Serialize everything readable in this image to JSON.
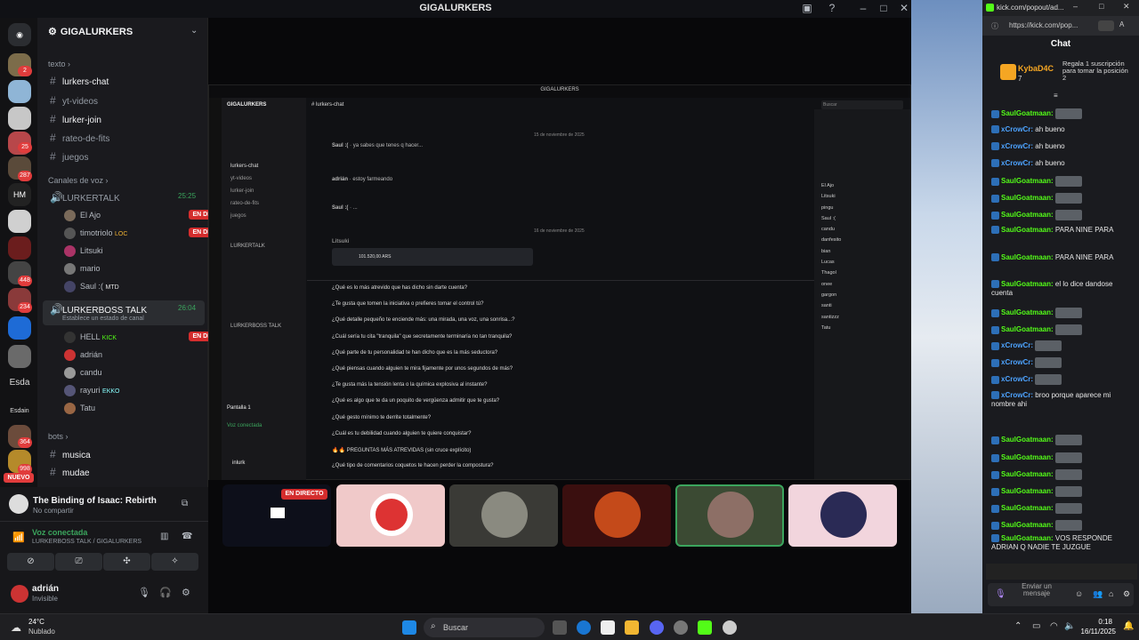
{
  "window": {
    "title": "GIGALURKERS"
  },
  "servers": {
    "badges": [
      "2",
      "25",
      "287",
      "448",
      "234",
      "364",
      "998"
    ],
    "labels": [
      "HM",
      "Esda",
      "Esdain"
    ],
    "nuevo": "NUEVO"
  },
  "sidebar": {
    "server_name": "GIGALURKERS",
    "cat_texto": "texto",
    "text_channels": [
      "lurkers-chat",
      "yt-videos",
      "lurker-join",
      "rateo-de-fits",
      "juegos"
    ],
    "cat_voz": "Canales de voz",
    "voice1": {
      "name": "LURKERTALK",
      "time": "25:25",
      "users": [
        {
          "name": "El Ajo",
          "live": "EN DIRECTO"
        },
        {
          "name": "timotriolo",
          "tag": "LOC",
          "live": "EN DIRECTO"
        },
        {
          "name": "Litsuki"
        },
        {
          "name": "mario"
        },
        {
          "name": "Saul :(",
          "tag": "MTD"
        }
      ]
    },
    "voice2": {
      "name": "LURKERBOSS TALK",
      "time": "26:04",
      "status": "Establece un estado de canal",
      "users": [
        {
          "name": "HELL",
          "tag": "KICK",
          "live": "EN DIRECTO"
        },
        {
          "name": "adrián"
        },
        {
          "name": "candu"
        },
        {
          "name": "rayuri",
          "tag": "EKKO"
        },
        {
          "name": "Tatu"
        }
      ]
    },
    "cat_bots": "bots",
    "bot_channels": [
      "musica",
      "mudae"
    ]
  },
  "activity": {
    "game": "The Binding of Isaac: Rebirth",
    "sub": "No compartir"
  },
  "voice_panel": {
    "status": "Voz conectada",
    "channel": "LURKERBOSS TALK / GIGALURKERS"
  },
  "user": {
    "name": "adrián",
    "status": "Invisible"
  },
  "stream": {
    "badge": "EN DIRECTO",
    "inner_title": "GIGALURKERS",
    "inner_server": "GIGALURKERS",
    "channel": "lurkers-chat",
    "search": "Buscar",
    "date1": "15 de noviembre de 2025",
    "date2": "16 de noviembre de 2025",
    "messages": [
      {
        "u": "Saul :(",
        "t": "ya sabes que tenes q hacer..."
      },
      {
        "u": "adrián",
        "t": "estoy farmeando"
      },
      {
        "u": "Saul :(",
        "t": "..."
      },
      {
        "u": "Litsuki",
        "t": "101.520,00 ARS"
      }
    ],
    "questions": [
      "¿Qué es lo más atrevido que has dicho sin darte cuenta?",
      "¿Te gusta que tomen la iniciativa o prefieres tomar el control tú?",
      "¿Qué detalle pequeño te enciende más: una mirada, una voz, una sonrisa...?",
      "¿Cuál sería tu cita \"tranquila\" que secretamente terminaría no tan tranquila?",
      "¿Qué parte de tu personalidad te han dicho que es la más seductora?",
      "¿Qué piensas cuando alguien te mira fijamente por unos segundos de más?",
      "¿Te gusta más la tensión lenta o la química explosiva al instante?",
      "¿Qué es algo que te da un poquito de vergüenza admitir que te gusta?",
      "¿Qué gesto mínimo te derrite totalmente?",
      "¿Cuál es tu debilidad cuando alguien te quiere conquistar?",
      "🔥🔥 PREGUNTAS MÁS ATREVIDAS (sin cruce explícito)",
      "¿Qué tipo de comentarios coquetos te hacen perder la compostura?"
    ],
    "members": [
      "El Ajo",
      "Litsuki",
      "pingu",
      "Saul :(",
      "candu",
      "danfesito",
      "bian",
      "Lucas",
      "Thagol",
      "onee",
      "gargon",
      "santi",
      "santizzz",
      "Tatu"
    ],
    "inner_voice": [
      "LURKERTALK",
      "LURKERBOSS TALK"
    ],
    "inner_user": "inlurk",
    "screen_label": "Pantalla 1",
    "voz_conectada": "Voz conectada"
  },
  "tiles": {
    "live_label": "EN DIRECTO"
  },
  "kick": {
    "url_host": "kick.com/popout/ad...",
    "url": "https://kick.com/pop...",
    "header": "Chat",
    "pinned_user": "KybaD4C",
    "pinned_count": "7",
    "pinned_text": "Regala 1 suscripción para tomar la posición 2",
    "messages": [
      {
        "u": "SaulGoatmaan:",
        "t": ""
      },
      {
        "u": "xCrowCr:",
        "t": "ah bueno"
      },
      {
        "u": "xCrowCr:",
        "t": "ah bueno"
      },
      {
        "u": "xCrowCr:",
        "t": "ah bueno"
      },
      {
        "u": "SaulGoatmaan:",
        "t": ""
      },
      {
        "u": "SaulGoatmaan:",
        "t": ""
      },
      {
        "u": "SaulGoatmaan:",
        "t": ""
      },
      {
        "u": "SaulGoatmaan:",
        "t": "PARA NINE PARA"
      },
      {
        "u": "SaulGoatmaan:",
        "t": "PARA NINE PARA"
      },
      {
        "u": "SaulGoatmaan:",
        "t": "el lo dice dandose cuenta"
      },
      {
        "u": "SaulGoatmaan:",
        "t": ""
      },
      {
        "u": "SaulGoatmaan:",
        "t": ""
      },
      {
        "u": "xCrowCr:",
        "t": ""
      },
      {
        "u": "xCrowCr:",
        "t": ""
      },
      {
        "u": "xCrowCr:",
        "t": ""
      },
      {
        "u": "xCrowCr:",
        "t": "broo porque aparece mi nombre ahi"
      },
      {
        "u": "SaulGoatmaan:",
        "t": ""
      },
      {
        "u": "SaulGoatmaan:",
        "t": ""
      },
      {
        "u": "SaulGoatmaan:",
        "t": ""
      },
      {
        "u": "SaulGoatmaan:",
        "t": ""
      },
      {
        "u": "SaulGoatmaan:",
        "t": ""
      },
      {
        "u": "SaulGoatmaan:",
        "t": ""
      },
      {
        "u": "SaulGoatmaan:",
        "t": "VOS RESPONDE ADRIAN Q NADIE TE JUZGUE"
      }
    ],
    "input_placeholder": "Enviar un mensaje"
  },
  "taskbar": {
    "temp": "24°C",
    "weather": "Nublado",
    "search": "Buscar",
    "time": "0:18",
    "date": "16/11/2025"
  }
}
